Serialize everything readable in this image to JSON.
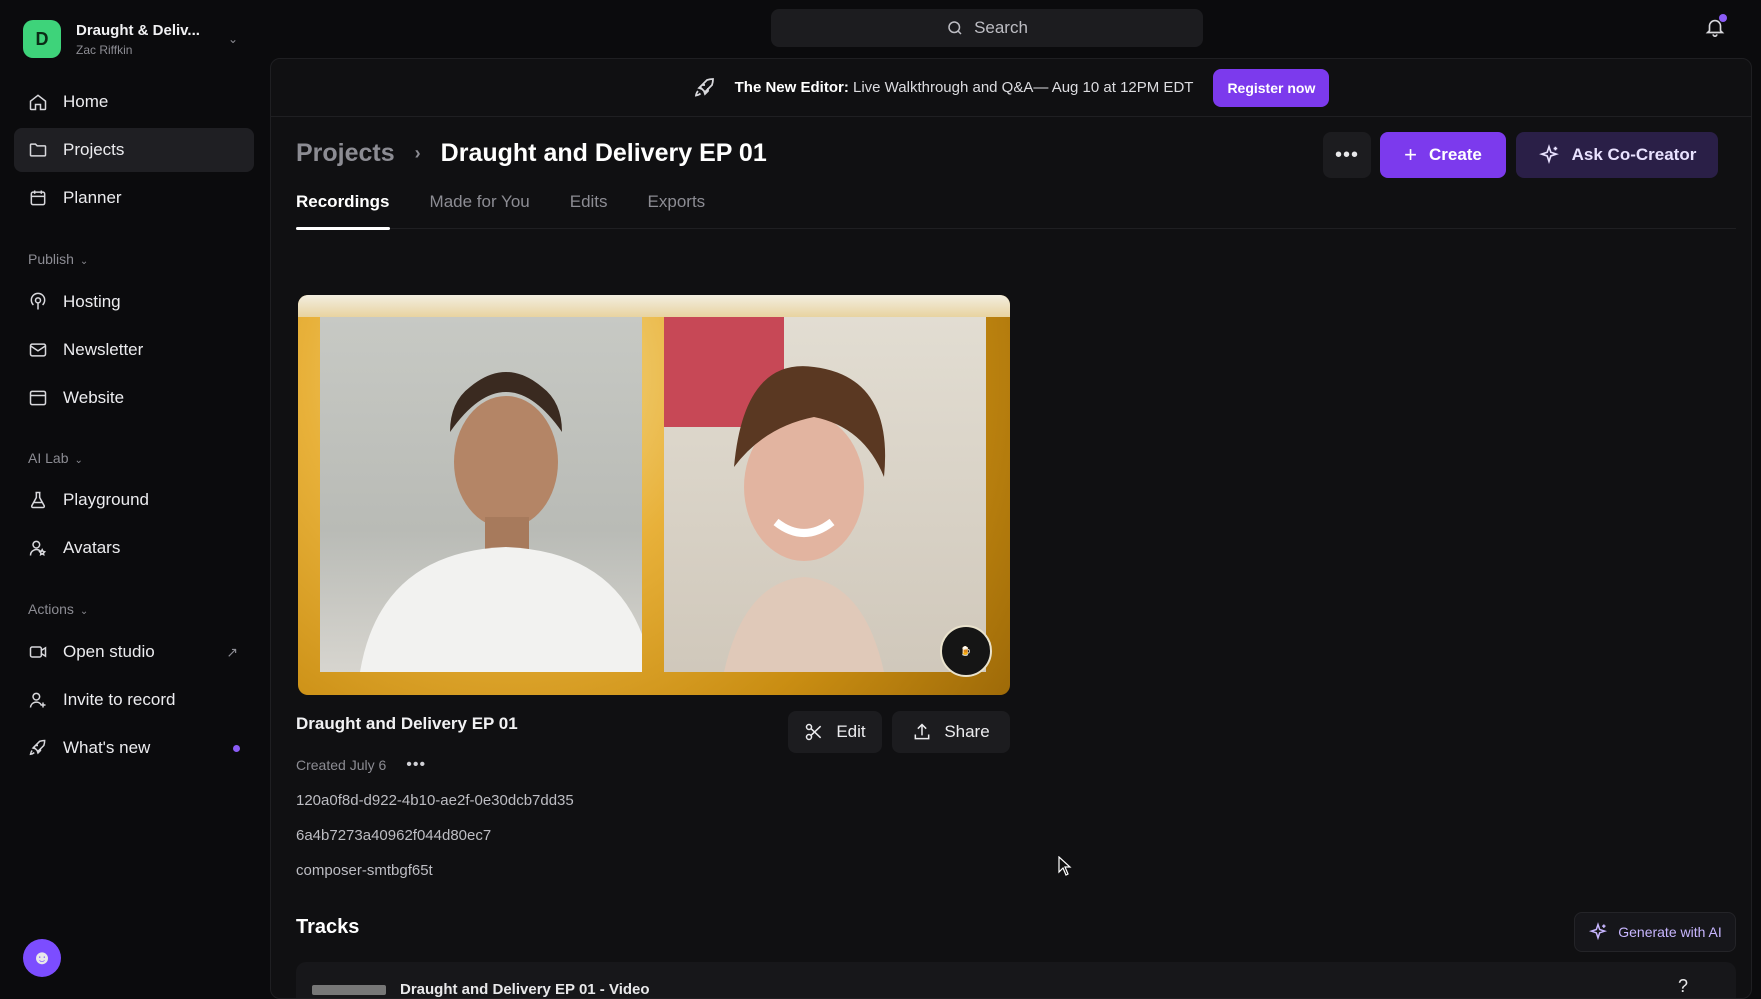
{
  "workspace": {
    "initial": "D",
    "name": "Draught & Deliv...",
    "user": "Zac Riffkin"
  },
  "nav": {
    "home": "Home",
    "projects": "Projects",
    "planner": "Planner",
    "publish_label": "Publish",
    "hosting": "Hosting",
    "newsletter": "Newsletter",
    "website": "Website",
    "ailab_label": "AI Lab",
    "playground": "Playground",
    "avatars": "Avatars",
    "actions_label": "Actions",
    "open_studio": "Open studio",
    "invite": "Invite to record",
    "whats_new": "What's new"
  },
  "search": {
    "placeholder": "Search"
  },
  "banner": {
    "bold": "The New Editor:",
    "text": "Live Walkthrough and Q&A— Aug 10 at 12PM EDT",
    "cta": "Register now"
  },
  "breadcrumb": {
    "root": "Projects",
    "separator": "›",
    "current": "Draught and Delivery EP 01"
  },
  "header_actions": {
    "more": "•••",
    "create": "Create",
    "cocreator": "Ask Co-Creator"
  },
  "tabs": [
    "Recordings",
    "Made for You",
    "Edits",
    "Exports"
  ],
  "recording": {
    "title": "Draught and Delivery EP 01",
    "created": "Created July 6",
    "more": "•••",
    "edit": "Edit",
    "share": "Share",
    "ids": [
      "120a0f8d-d922-4b10-ae2f-0e30dcb7dd35",
      "6a4b7273a40962f044d80ec7",
      "composer-smtbgf65t"
    ]
  },
  "tracks": {
    "heading": "Tracks",
    "generate": "Generate with AI",
    "row_label": "Draught and Delivery EP 01 - Video",
    "row_action": "?"
  },
  "colors": {
    "accent": "#7c3aed",
    "workspace_avatar": "#3ed37a",
    "notification_dot": "#8b5cf6"
  },
  "icons": [
    "home-icon",
    "folder-icon",
    "calendar-icon",
    "podcast-icon",
    "mail-icon",
    "browser-icon",
    "flask-icon",
    "avatar-icon",
    "video-icon",
    "user-plus-icon",
    "rocket-icon",
    "search-icon",
    "bell-icon",
    "sparkle-icon",
    "scissors-icon",
    "upload-icon"
  ]
}
